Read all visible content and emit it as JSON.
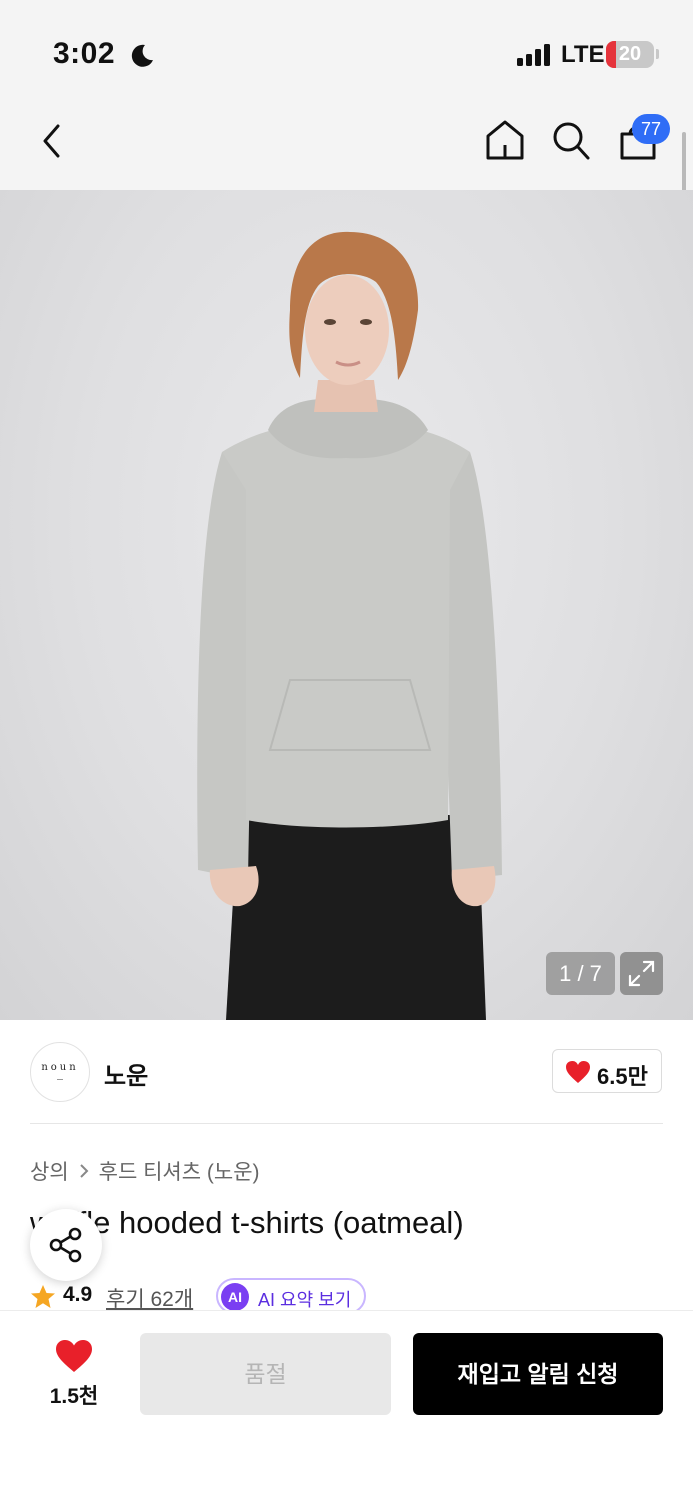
{
  "status_bar": {
    "time": "3:02",
    "network": "LTE",
    "battery_level": "20",
    "battery_fraction": 0.2,
    "battery_color": "#e5333b",
    "icons": [
      "moon-icon",
      "signal-icon",
      "battery-icon"
    ]
  },
  "nav": {
    "cart_count": "77",
    "icons": [
      "back-arrow-icon",
      "home-icon",
      "search-icon",
      "cart-icon"
    ],
    "badge_color": "#2f6df6"
  },
  "gallery": {
    "counter": "1 / 7",
    "icons": [
      "expand-icon"
    ]
  },
  "brand": {
    "logo_text": "noun",
    "name": "노운",
    "like_count": "6.5만",
    "icons": [
      "heart-icon"
    ]
  },
  "product": {
    "breadcrumb": [
      "상의",
      "후드 티셔츠 (노운)"
    ],
    "title": "waffle hooded t-shirts (oatmeal)",
    "rating": "4.9",
    "review_label": "후기 62개",
    "ai_badge": "AI",
    "ai_label": "AI 요약 보기",
    "icons": [
      "share-icon",
      "star-icon"
    ]
  },
  "bottom_bar": {
    "wish_count": "1.5천",
    "soldout_label": "품절",
    "restock_label": "재입고 알림 신청",
    "accent_red": "#e8202a"
  }
}
